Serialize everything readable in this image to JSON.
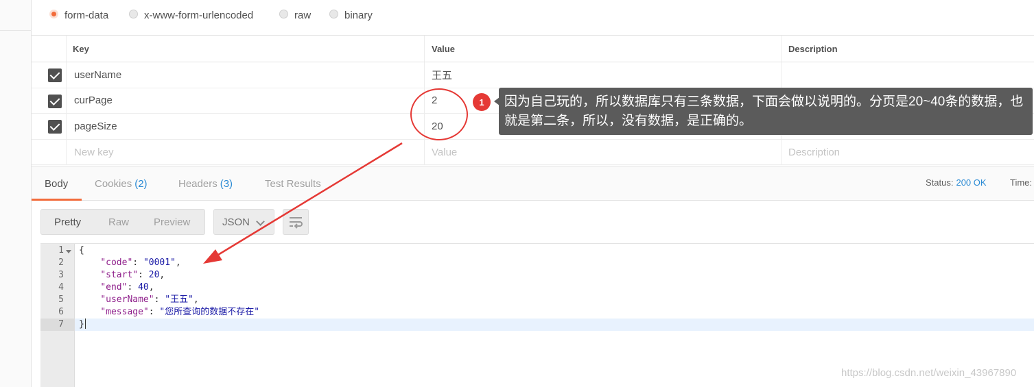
{
  "body_types": [
    {
      "label": "form-data",
      "selected": true
    },
    {
      "label": "x-www-form-urlencoded",
      "selected": false
    },
    {
      "label": "raw",
      "selected": false
    },
    {
      "label": "binary",
      "selected": false
    }
  ],
  "params_table": {
    "headers": {
      "key": "Key",
      "value": "Value",
      "description": "Description"
    },
    "rows": [
      {
        "key": "userName",
        "value": "王五",
        "description": "",
        "checked": true
      },
      {
        "key": "curPage",
        "value": "2",
        "description": "",
        "checked": true
      },
      {
        "key": "pageSize",
        "value": "20",
        "description": "",
        "checked": true
      }
    ],
    "new_row": {
      "key_placeholder": "New key",
      "value_placeholder": "Value",
      "description_placeholder": "Description"
    }
  },
  "response_tabs": {
    "body": "Body",
    "cookies": "Cookies",
    "cookies_count": "(2)",
    "headers": "Headers",
    "headers_count": "(3)",
    "test_results": "Test Results",
    "active": "Body"
  },
  "status": {
    "label": "Status:",
    "value": "200 OK",
    "time_label": "Time:"
  },
  "view_modes": {
    "pretty": "Pretty",
    "raw": "Raw",
    "preview": "Preview",
    "active": "Pretty"
  },
  "format_select": {
    "value": "JSON"
  },
  "icons": {
    "wrap": "wrap-lines-icon",
    "fold": "fold-arrow-icon",
    "check": "checkmark-icon",
    "chevron": "chevron-down-icon"
  },
  "code_lines": {
    "numbers": [
      "1",
      "2",
      "3",
      "4",
      "5",
      "6",
      "7"
    ],
    "open": "{",
    "code_key": "\"code\"",
    "code_val": "\"0001\"",
    "start_key": "\"start\"",
    "start_val": "20",
    "end_key": "\"end\"",
    "end_val": "40",
    "username_key": "\"userName\"",
    "username_val": "\"王五\"",
    "message_key": "\"message\"",
    "message_val": "\"您所查询的数据不存在\"",
    "close": "}"
  },
  "annotation": {
    "badge": "1",
    "text": "因为自己玩的，所以数据库只有三条数据，下面会做以说明的。分页是20~40条的数据，也就是第二条，所以，没有数据，是正确的。",
    "color": "#e53935"
  },
  "watermark": "https://blog.csdn.net/weixin_43967890",
  "colors": {
    "accent": "#f26b3a",
    "link": "#2a8ad4",
    "json_key": "#8e1d8a",
    "json_value": "#1a1aa6"
  }
}
